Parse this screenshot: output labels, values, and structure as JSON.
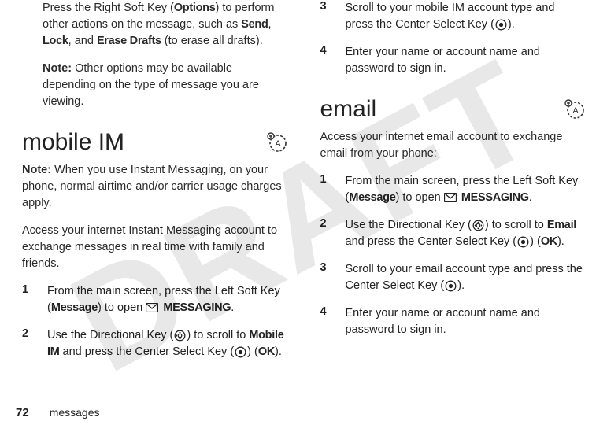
{
  "watermark": "DRAFT",
  "left": {
    "intro_pre": "Press the Right Soft Key (",
    "intro_options": "Options",
    "intro_mid": ") to perform other actions on the message, such as ",
    "send": "Send",
    "comma1": ", ",
    "lock": "Lock",
    "comma2": ", and ",
    "erase": "Erase Drafts",
    "intro_end": " (to erase all drafts).",
    "note_label": "Note:",
    "note_text": " Other options may be available depending on the type of message you are viewing.",
    "heading": "mobile IM",
    "note2_label": "Note:",
    "note2_text": " When you use Instant Messaging, on your phone, normal airtime and/or carrier usage charges apply.",
    "access_text": "Access your internet Instant Messaging account to exchange messages in real time with family and friends.",
    "steps": [
      {
        "n": "1",
        "pre": "From the main screen, press the Left Soft Key (",
        "key": "Message",
        "mid": ") to open ",
        "label": "MESSAGING",
        "end": "."
      },
      {
        "n": "2",
        "pre": "Use the Directional Key (",
        "mid1": ") to scroll to ",
        "target": "Mobile IM",
        "mid2": " and press the Center Select Key (",
        "ok": "OK",
        "end": ")."
      }
    ]
  },
  "right": {
    "steps_top": [
      {
        "n": "3",
        "pre": "Scroll to your mobile IM account type and press the Center Select Key (",
        "end": ")."
      },
      {
        "n": "4",
        "text": "Enter your name or account name and password to sign in."
      }
    ],
    "heading": "email",
    "access_text": "Access your internet email account to exchange email from your phone:",
    "steps": [
      {
        "n": "1",
        "pre": "From the main screen, press the Left Soft Key (",
        "key": "Message",
        "mid": ") to open ",
        "label": "MESSAGING",
        "end": "."
      },
      {
        "n": "2",
        "pre": "Use the Directional Key (",
        "mid1": ") to scroll to ",
        "target": "Email",
        "mid2": " and press the Center Select Key (",
        "ok": "OK",
        "end": ")."
      },
      {
        "n": "3",
        "pre": "Scroll to your email account type and press the Center Select Key (",
        "end": ")."
      },
      {
        "n": "4",
        "text": "Enter your name or account name and password to sign in."
      }
    ]
  },
  "footer": {
    "page": "72",
    "label": "messages"
  }
}
